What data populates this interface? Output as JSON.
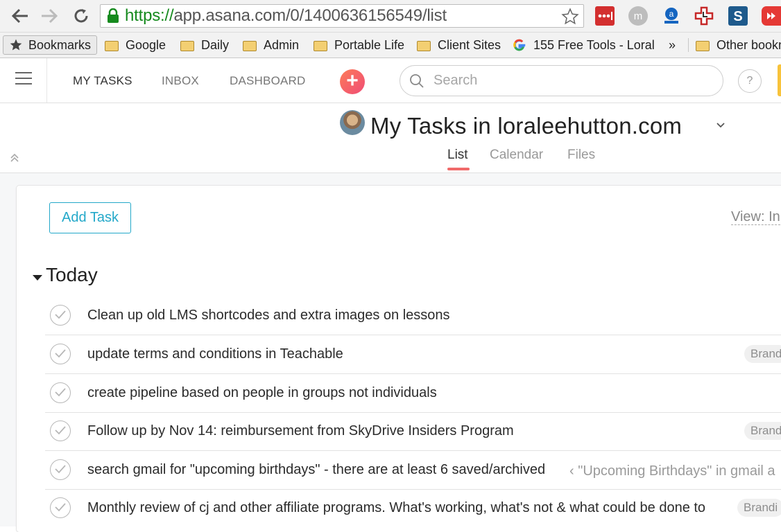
{
  "browser": {
    "url_scheme": "https://",
    "url_rest": "app.asana.com/0/1400636156549/list",
    "bookmarks": [
      {
        "label": "Bookmarks",
        "icon": "star-icon"
      },
      {
        "label": "Google",
        "icon": "folder-icon"
      },
      {
        "label": "Daily",
        "icon": "folder-icon"
      },
      {
        "label": "Admin",
        "icon": "folder-icon"
      },
      {
        "label": "Portable Life",
        "icon": "folder-icon"
      },
      {
        "label": "Client Sites",
        "icon": "folder-icon"
      },
      {
        "label": "155 Free Tools - Lorale",
        "icon": "google-icon"
      },
      {
        "label": "»",
        "icon": "overflow-icon"
      },
      {
        "label": "Other bookm",
        "icon": "folder-icon"
      }
    ],
    "extensions": [
      "lastpass-icon",
      "m-extension-icon",
      "amazon-assistant-icon",
      "medical-cross-extension-icon",
      "s-extension-icon",
      "youtube-extension-icon"
    ]
  },
  "topbar": {
    "nav": [
      "MY TASKS",
      "INBOX",
      "DASHBOARD"
    ],
    "add_symbol": "+",
    "search_placeholder": "Search",
    "help_symbol": "?"
  },
  "page": {
    "title": "My Tasks in loraleehutton.com",
    "tabs": [
      "List",
      "Calendar",
      "Files"
    ],
    "active_tab": "List"
  },
  "list": {
    "add_task_label": "Add Task",
    "view_label": "View: In",
    "section_title": "Today",
    "tasks": [
      {
        "name": "Clean up old LMS shortcodes and extra images on lessons",
        "tag": ""
      },
      {
        "name": "update terms and conditions in Teachable",
        "tag": "Brand"
      },
      {
        "name": "create pipeline based on people in groups not individuals",
        "tag": ""
      },
      {
        "name": "Follow up by Nov 14: reimbursement from SkyDrive Insiders Program",
        "tag": "Brand"
      },
      {
        "name": "search gmail for \"upcoming birthdays\" - there are at least 6 saved/archived",
        "parent_hint": "‹ \"Upcoming Birthdays\" in gmail a",
        "tag": ""
      },
      {
        "name": "Monthly review of cj and other affiliate programs.  What's working, what's not & what could be done to",
        "tag": "Brandi"
      }
    ]
  },
  "colors": {
    "accent_teal": "#23a8c9",
    "tab_underline": "#f06a6a",
    "add_button_gradient_start": "#fc7b58",
    "add_button_gradient_end": "#f04d76",
    "secure_green": "#168a1e"
  }
}
